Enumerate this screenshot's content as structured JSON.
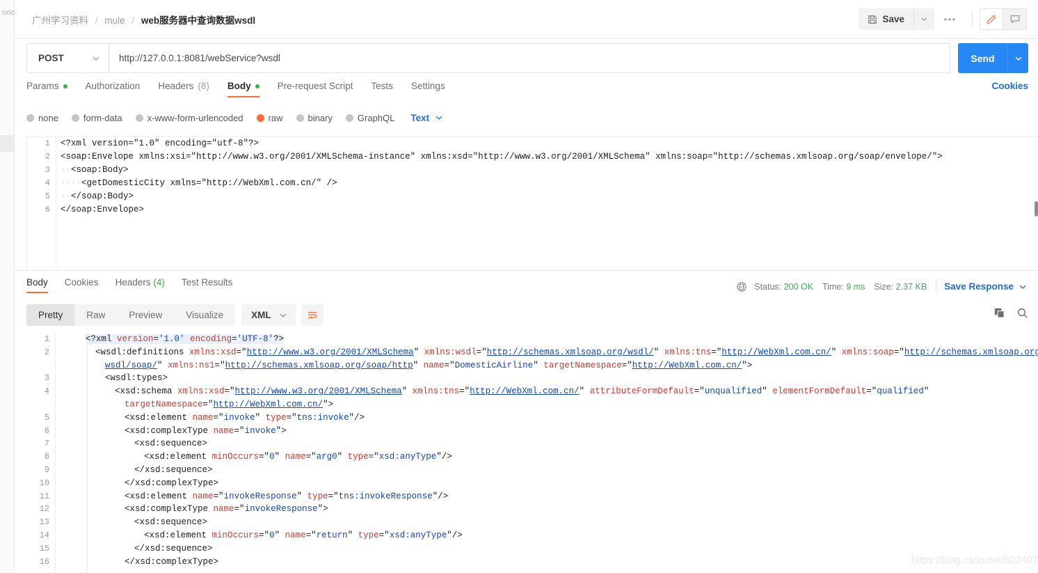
{
  "header": {
    "breadcrumb": {
      "workspace": "广州学习资料",
      "collection": "mule",
      "current": "web服务器中查询数据wsdl"
    },
    "save_label": "Save",
    "save_icon": "floppy-disk-icon",
    "caret_icon": "chevron-down-icon",
    "more_icon": "ellipsis-icon",
    "edit_icon": "pencil-icon",
    "comment_icon": "comment-icon",
    "accent_orange": "#ff6c37",
    "accent_blue": "#2588f5"
  },
  "request": {
    "method": "POST",
    "url": "http://127.0.0.1:8081/webService?wsdl",
    "send_label": "Send",
    "tabs": [
      {
        "label": "Params",
        "badge": "dot",
        "active": false
      },
      {
        "label": "Authorization",
        "badge": "",
        "active": false
      },
      {
        "label": "Headers",
        "count": "(8)",
        "badge": "count",
        "active": false
      },
      {
        "label": "Body",
        "badge": "dot",
        "active": true
      },
      {
        "label": "Pre-request Script",
        "badge": "",
        "active": false
      },
      {
        "label": "Tests",
        "badge": "",
        "active": false
      },
      {
        "label": "Settings",
        "badge": "",
        "active": false
      }
    ],
    "cookies_link": "Cookies",
    "body_types": [
      {
        "label": "none",
        "selected": false
      },
      {
        "label": "form-data",
        "selected": false
      },
      {
        "label": "x-www-form-urlencoded",
        "selected": false
      },
      {
        "label": "raw",
        "selected": true
      },
      {
        "label": "binary",
        "selected": false
      },
      {
        "label": "GraphQL",
        "selected": false
      }
    ],
    "raw_format": "Text",
    "body_lines": [
      {
        "n": "1",
        "text": "<?xml version=\"1.0\" encoding=\"utf-8\"?>"
      },
      {
        "n": "2",
        "text": "<soap:Envelope xmlns:xsi=\"http://www.w3.org/2001/XMLSchema-instance\" xmlns:xsd=\"http://www.w3.org/2001/XMLSchema\" xmlns:soap=\"http://schemas.xmlsoap.org/soap/envelope/\">"
      },
      {
        "n": "3",
        "text": "  <soap:Body>"
      },
      {
        "n": "4",
        "text": "    <getDomesticCity xmlns=\"http://WebXml.com.cn/\" />"
      },
      {
        "n": "5",
        "text": "  </soap:Body>"
      },
      {
        "n": "6",
        "text": "</soap:Envelope>"
      }
    ]
  },
  "response": {
    "tabs": [
      {
        "label": "Body",
        "active": true
      },
      {
        "label": "Cookies",
        "active": false
      },
      {
        "label": "Headers",
        "count": "(4)",
        "active": false
      },
      {
        "label": "Test Results",
        "active": false
      }
    ],
    "status_label": "Status:",
    "status_value": "200 OK",
    "time_label": "Time:",
    "time_value": "9 ms",
    "size_label": "Size:",
    "size_value": "2.37 KB",
    "save_response": "Save Response",
    "globe_icon": "globe-icon",
    "view_modes": [
      {
        "label": "Pretty",
        "active": true
      },
      {
        "label": "Raw",
        "active": false
      },
      {
        "label": "Preview",
        "active": false
      },
      {
        "label": "Visualize",
        "active": false
      }
    ],
    "format": "XML",
    "wrap_icon": "wrap-lines-icon",
    "copy_icon": "copy-icon",
    "search_icon": "search-icon",
    "body_lines": [
      {
        "n": "1",
        "indent": 0,
        "parts": [
          {
            "t": "pi",
            "v": "<?xml "
          },
          {
            "t": "attr",
            "v": "version"
          },
          {
            "t": "pi",
            "v": "="
          },
          {
            "t": "val",
            "v": "'1.0'"
          },
          {
            "t": "pi",
            "v": " "
          },
          {
            "t": "attr",
            "v": "encoding"
          },
          {
            "t": "pi",
            "v": "="
          },
          {
            "t": "val",
            "v": "'UTF-8'"
          },
          {
            "t": "pi",
            "v": "?>"
          }
        ]
      },
      {
        "n": "2",
        "indent": 1,
        "parts": [
          {
            "t": "tag",
            "v": "<wsdl:definitions "
          },
          {
            "t": "attr",
            "v": "xmlns:xsd"
          },
          {
            "t": "tag",
            "v": "=\""
          },
          {
            "t": "lnk",
            "v": "http://www.w3.org/2001/XMLSchema"
          },
          {
            "t": "tag",
            "v": "\" "
          },
          {
            "t": "attr",
            "v": "xmlns:wsdl"
          },
          {
            "t": "tag",
            "v": "=\""
          },
          {
            "t": "lnk",
            "v": "http://schemas.xmlsoap.org/wsdl/"
          },
          {
            "t": "tag",
            "v": "\" "
          },
          {
            "t": "attr",
            "v": "xmlns:tns"
          },
          {
            "t": "tag",
            "v": "=\""
          },
          {
            "t": "lnk",
            "v": "http://WebXml.com.cn/"
          },
          {
            "t": "tag",
            "v": "\" "
          },
          {
            "t": "attr",
            "v": "xmlns:soap"
          },
          {
            "t": "tag",
            "v": "=\""
          },
          {
            "t": "lnk",
            "v": "http://schemas.xmlsoap.org/"
          }
        ]
      },
      {
        "n": "",
        "indent": 2,
        "parts": [
          {
            "t": "lnk",
            "v": "wsdl/soap/"
          },
          {
            "t": "tag",
            "v": "\" "
          },
          {
            "t": "attr",
            "v": "xmlns:ns1"
          },
          {
            "t": "tag",
            "v": "=\""
          },
          {
            "t": "lnk",
            "v": "http://schemas.xmlsoap.org/soap/http"
          },
          {
            "t": "tag",
            "v": "\" "
          },
          {
            "t": "attr",
            "v": "name"
          },
          {
            "t": "tag",
            "v": "=\""
          },
          {
            "t": "val",
            "v": "DomesticAirline"
          },
          {
            "t": "tag",
            "v": "\" "
          },
          {
            "t": "attr",
            "v": "targetNamespace"
          },
          {
            "t": "tag",
            "v": "=\""
          },
          {
            "t": "lnk",
            "v": "http://WebXml.com.cn/"
          },
          {
            "t": "tag",
            "v": "\">"
          }
        ]
      },
      {
        "n": "3",
        "indent": 2,
        "parts": [
          {
            "t": "tag",
            "v": "<wsdl:types>"
          }
        ]
      },
      {
        "n": "4",
        "indent": 3,
        "parts": [
          {
            "t": "tag",
            "v": "<xsd:schema "
          },
          {
            "t": "attr",
            "v": "xmlns:xsd"
          },
          {
            "t": "tag",
            "v": "=\""
          },
          {
            "t": "lnk",
            "v": "http://www.w3.org/2001/XMLSchema"
          },
          {
            "t": "tag",
            "v": "\" "
          },
          {
            "t": "attr",
            "v": "xmlns:tns"
          },
          {
            "t": "tag",
            "v": "=\""
          },
          {
            "t": "lnk",
            "v": "http://WebXml.com.cn/"
          },
          {
            "t": "tag",
            "v": "\" "
          },
          {
            "t": "attr",
            "v": "attributeFormDefault"
          },
          {
            "t": "tag",
            "v": "=\""
          },
          {
            "t": "val",
            "v": "unqualified"
          },
          {
            "t": "tag",
            "v": "\" "
          },
          {
            "t": "attr",
            "v": "elementFormDefault"
          },
          {
            "t": "tag",
            "v": "=\""
          },
          {
            "t": "val",
            "v": "qualified"
          },
          {
            "t": "tag",
            "v": "\""
          }
        ]
      },
      {
        "n": "",
        "indent": 4,
        "parts": [
          {
            "t": "attr",
            "v": "targetNamespace"
          },
          {
            "t": "tag",
            "v": "=\""
          },
          {
            "t": "lnk",
            "v": "http://WebXml.com.cn/"
          },
          {
            "t": "tag",
            "v": "\">"
          }
        ]
      },
      {
        "n": "5",
        "indent": 4,
        "parts": [
          {
            "t": "tag",
            "v": "<xsd:element "
          },
          {
            "t": "attr",
            "v": "name"
          },
          {
            "t": "tag",
            "v": "=\""
          },
          {
            "t": "val",
            "v": "invoke"
          },
          {
            "t": "tag",
            "v": "\" "
          },
          {
            "t": "attr",
            "v": "type"
          },
          {
            "t": "tag",
            "v": "=\""
          },
          {
            "t": "val",
            "v": "tns:invoke"
          },
          {
            "t": "tag",
            "v": "\"/>"
          }
        ]
      },
      {
        "n": "6",
        "indent": 4,
        "parts": [
          {
            "t": "tag",
            "v": "<xsd:complexType "
          },
          {
            "t": "attr",
            "v": "name"
          },
          {
            "t": "tag",
            "v": "=\""
          },
          {
            "t": "val",
            "v": "invoke"
          },
          {
            "t": "tag",
            "v": "\">"
          }
        ]
      },
      {
        "n": "7",
        "indent": 5,
        "parts": [
          {
            "t": "tag",
            "v": "<xsd:sequence>"
          }
        ]
      },
      {
        "n": "8",
        "indent": 6,
        "parts": [
          {
            "t": "tag",
            "v": "<xsd:element "
          },
          {
            "t": "attr",
            "v": "minOccurs"
          },
          {
            "t": "tag",
            "v": "=\""
          },
          {
            "t": "val",
            "v": "0"
          },
          {
            "t": "tag",
            "v": "\" "
          },
          {
            "t": "attr",
            "v": "name"
          },
          {
            "t": "tag",
            "v": "=\""
          },
          {
            "t": "val",
            "v": "arg0"
          },
          {
            "t": "tag",
            "v": "\" "
          },
          {
            "t": "attr",
            "v": "type"
          },
          {
            "t": "tag",
            "v": "=\""
          },
          {
            "t": "val",
            "v": "xsd:anyType"
          },
          {
            "t": "tag",
            "v": "\"/>"
          }
        ]
      },
      {
        "n": "9",
        "indent": 5,
        "parts": [
          {
            "t": "tag",
            "v": "</xsd:sequence>"
          }
        ]
      },
      {
        "n": "10",
        "indent": 4,
        "parts": [
          {
            "t": "tag",
            "v": "</xsd:complexType>"
          }
        ]
      },
      {
        "n": "11",
        "indent": 4,
        "parts": [
          {
            "t": "tag",
            "v": "<xsd:element "
          },
          {
            "t": "attr",
            "v": "name"
          },
          {
            "t": "tag",
            "v": "=\""
          },
          {
            "t": "val",
            "v": "invokeResponse"
          },
          {
            "t": "tag",
            "v": "\" "
          },
          {
            "t": "attr",
            "v": "type"
          },
          {
            "t": "tag",
            "v": "=\""
          },
          {
            "t": "val",
            "v": "tns:invokeResponse"
          },
          {
            "t": "tag",
            "v": "\"/>"
          }
        ]
      },
      {
        "n": "12",
        "indent": 4,
        "parts": [
          {
            "t": "tag",
            "v": "<xsd:complexType "
          },
          {
            "t": "attr",
            "v": "name"
          },
          {
            "t": "tag",
            "v": "=\""
          },
          {
            "t": "val",
            "v": "invokeResponse"
          },
          {
            "t": "tag",
            "v": "\">"
          }
        ]
      },
      {
        "n": "13",
        "indent": 5,
        "parts": [
          {
            "t": "tag",
            "v": "<xsd:sequence>"
          }
        ]
      },
      {
        "n": "14",
        "indent": 6,
        "parts": [
          {
            "t": "tag",
            "v": "<xsd:element "
          },
          {
            "t": "attr",
            "v": "minOccurs"
          },
          {
            "t": "tag",
            "v": "=\""
          },
          {
            "t": "val",
            "v": "0"
          },
          {
            "t": "tag",
            "v": "\" "
          },
          {
            "t": "attr",
            "v": "name"
          },
          {
            "t": "tag",
            "v": "=\""
          },
          {
            "t": "val",
            "v": "return"
          },
          {
            "t": "tag",
            "v": "\" "
          },
          {
            "t": "attr",
            "v": "type"
          },
          {
            "t": "tag",
            "v": "=\""
          },
          {
            "t": "val",
            "v": "xsd:anyType"
          },
          {
            "t": "tag",
            "v": "\"/>"
          }
        ]
      },
      {
        "n": "15",
        "indent": 5,
        "parts": [
          {
            "t": "tag",
            "v": "</xsd:sequence>"
          }
        ]
      },
      {
        "n": "16",
        "indent": 4,
        "parts": [
          {
            "t": "tag",
            "v": "</xsd:complexType>"
          }
        ]
      }
    ]
  },
  "watermark": "https://blog.csdn.net/h22407"
}
